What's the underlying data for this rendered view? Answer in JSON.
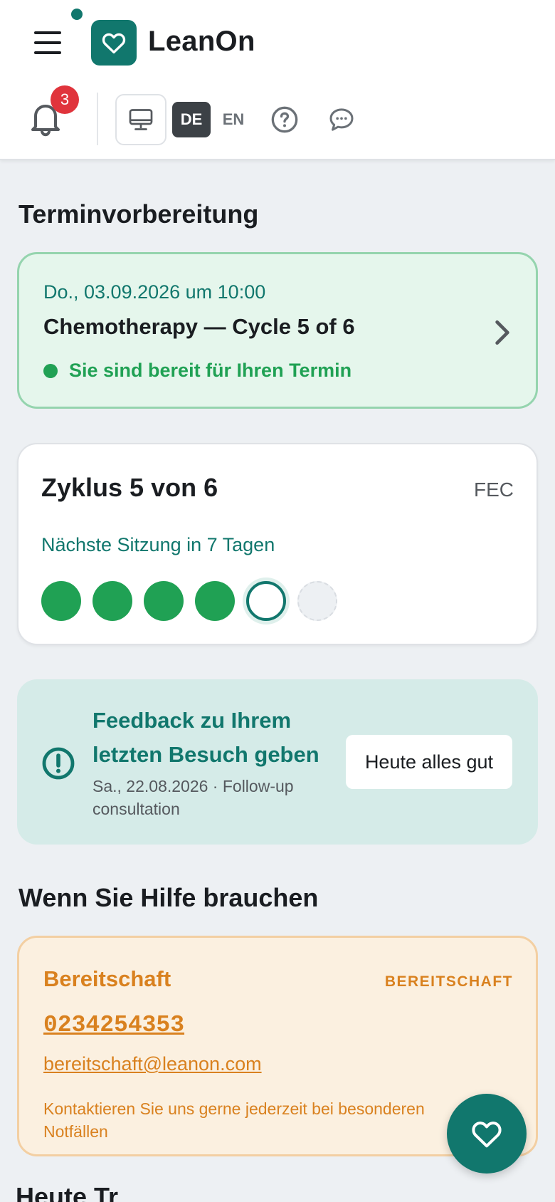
{
  "header": {
    "brand": "LeanOn",
    "notification_count": "3",
    "languages": {
      "active": "DE",
      "other": "EN"
    },
    "icons": {
      "menu": "hamburger-menu-icon",
      "logo": "heart-icon",
      "notifications": "bell-icon",
      "device": "monitor-icon",
      "help": "question-circle-icon",
      "chat": "chat-bubble-icon"
    }
  },
  "appointment_prep": {
    "title": "Terminvorbereitung",
    "card": {
      "date": "Do., 03.09.2026 um 10:00",
      "title": "Chemotherapy — Cycle 5 of 6",
      "status": "Sie sind bereit für Ihren Termin",
      "status_color": "#20a154"
    }
  },
  "cycle": {
    "title": "Zyklus 5 von 6",
    "regimen": "FEC",
    "next_session": "Nächste Sitzung in 7 Tagen",
    "completed": 4,
    "current": 5,
    "total": 6
  },
  "feedback": {
    "title": "Feedback zu Ihrem letzten Besuch geben",
    "subtitle": "Sa., 22.08.2026 · Follow-up consultation",
    "button": "Heute alles gut",
    "icon": "exclamation-circle-icon"
  },
  "help": {
    "title": "Wenn Sie Hilfe brauchen",
    "contact": {
      "name": "Bereitschaft",
      "tag": "BEREITSCHAFT",
      "phone": "0234254353",
      "email": "bereitschaft@leanon.com",
      "note": "Kontaktieren Sie uns gerne jederzeit bei besonderen Notfällen"
    }
  },
  "next_section_title_partial": "Heute Tr",
  "colors": {
    "brand": "#11776d",
    "success": "#20a154",
    "warning": "#d9811f",
    "badge": "#e0343c"
  },
  "fab": {
    "icon": "heart-icon"
  }
}
